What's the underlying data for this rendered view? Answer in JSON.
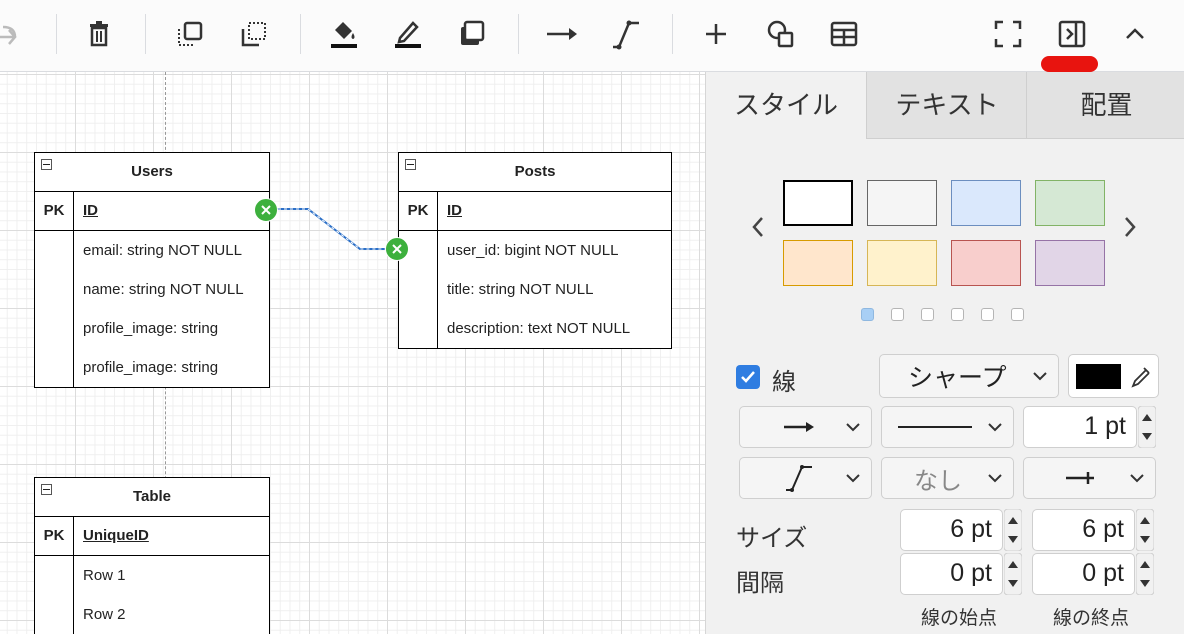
{
  "toolbar": {
    "buttons": [
      "redo-icon",
      "delete-icon",
      "to-front-icon",
      "to-back-icon",
      "fill-color-icon",
      "line-color-icon",
      "shadow-icon",
      "connection-arrow-icon",
      "waypoints-icon",
      "insert-icon",
      "shape-icon",
      "table-icon",
      "fullscreen-icon",
      "format-panel-icon",
      "collapse-icon"
    ],
    "highlight_color": "#e8140f"
  },
  "diagram": {
    "users": {
      "title": "Users",
      "pk": "PK",
      "pk_name": "ID",
      "rows": [
        "email: string NOT NULL",
        "name: string NOT NULL",
        "profile_image: string",
        "profile_image: string"
      ]
    },
    "posts": {
      "title": "Posts",
      "pk": "PK",
      "pk_name": "ID",
      "rows": [
        "user_id: bigint NOT NULL",
        "title: string NOT NULL",
        "description: text NOT NULL"
      ]
    },
    "table": {
      "title": "Table",
      "pk": "PK",
      "pk_name": "UniqueID",
      "rows": [
        "Row 1",
        "Row 2"
      ]
    }
  },
  "panel": {
    "tabs": [
      "スタイル",
      "テキスト",
      "配置"
    ],
    "swatches": [
      {
        "fill": "#ffffff",
        "stroke": "#000000"
      },
      {
        "fill": "#f5f5f5",
        "stroke": "#666666"
      },
      {
        "fill": "#dae8fc",
        "stroke": "#6c8ebf"
      },
      {
        "fill": "#d5e8d4",
        "stroke": "#82b366"
      },
      {
        "fill": "#ffe6cc",
        "stroke": "#d79b00"
      },
      {
        "fill": "#fff2cc",
        "stroke": "#d6b656"
      },
      {
        "fill": "#f8cecc",
        "stroke": "#b85450"
      },
      {
        "fill": "#e1d5e7",
        "stroke": "#9673a6"
      }
    ],
    "page_dots": 6,
    "active_dot": 0,
    "line_checkbox_label": "線",
    "line_checked": true,
    "line_style": "シャープ",
    "line_color": "#000000",
    "width_value": "1 pt",
    "none_label": "なし",
    "size_label": "サイズ",
    "spacing_label": "間隔",
    "size_start": "6 pt",
    "size_end": "6 pt",
    "spacing_start": "0 pt",
    "spacing_end": "0 pt",
    "start_label": "線の始点",
    "end_label": "線の終点"
  }
}
